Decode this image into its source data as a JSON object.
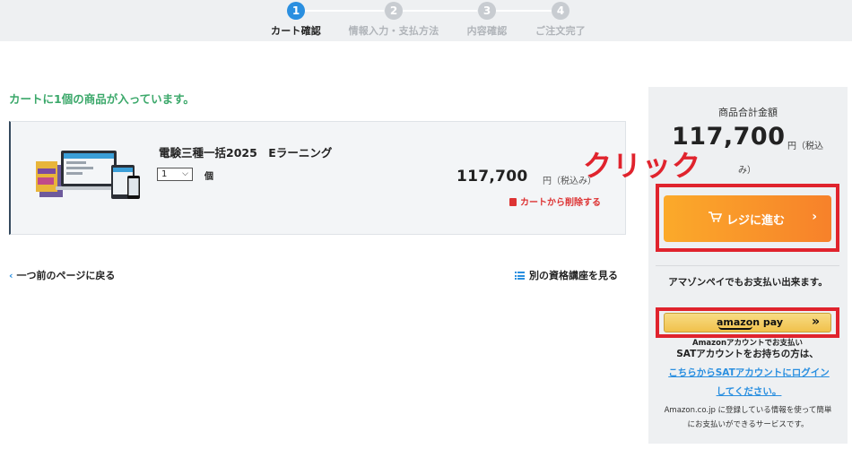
{
  "stepper": {
    "steps": [
      {
        "number": "1",
        "label": "カート確認",
        "active": true
      },
      {
        "number": "2",
        "label": "情報入力・支払方法",
        "active": false
      },
      {
        "number": "3",
        "label": "内容確認",
        "active": false
      },
      {
        "number": "4",
        "label": "ご注文完了",
        "active": false
      }
    ]
  },
  "cart": {
    "count_message": "カートに1個の商品が入っています。",
    "item": {
      "name": "電験三種一括2025　Eラーニング",
      "quantity": "1",
      "quantity_unit": "個",
      "price": "117,700",
      "price_unit": "円（税込み）",
      "remove_label": "カートから削除する"
    },
    "back_link": "一つ前のページに戻る",
    "other_courses_link": "別の資格講座を見る"
  },
  "summary": {
    "label": "商品合計金額",
    "total": "117,700",
    "unit_line1": "円（税込",
    "unit_line2": "み）",
    "checkout_label": "レジに進む",
    "amazon_note": "アマゾンペイでもお支払い出来ます。",
    "amazon_button_label": "amazon pay",
    "amazon_caption": "Amazonアカウントでお支払い",
    "sat_text": "SATアカウントをお持ちの方は、",
    "sat_link": "こちらからSATアカウントにログインしてください。",
    "amazon_footnote": "Amazon.co.jp に登録している情報を使って簡単にお支払いができるサービスです。"
  },
  "annotation": {
    "text": "クリック",
    "color": "#e0232d"
  },
  "colors": {
    "accent_blue": "#2a8fe0",
    "accent_green": "#3ba86a",
    "checkout_orange": "#f7812a",
    "remove_red": "#d33333"
  }
}
